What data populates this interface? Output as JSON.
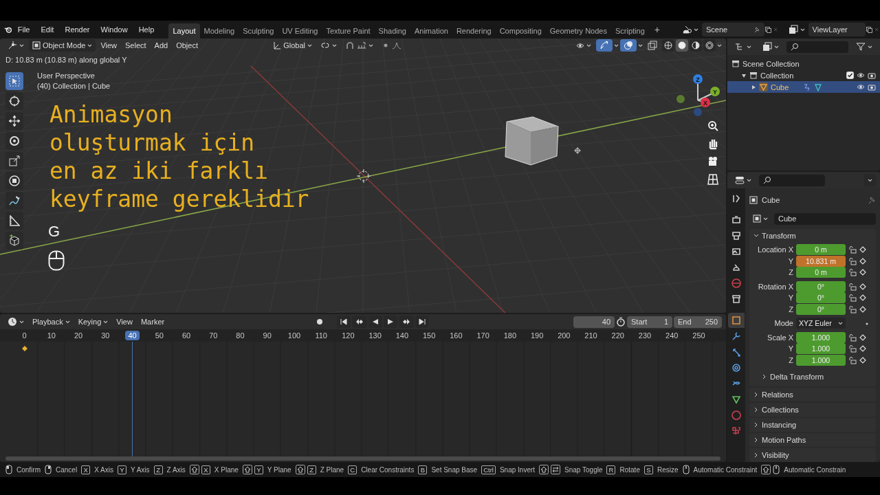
{
  "menu": [
    "File",
    "Edit",
    "Render",
    "Window",
    "Help"
  ],
  "workspaces": [
    {
      "label": "Layout",
      "selected": true
    },
    {
      "label": "Modeling",
      "selected": false
    },
    {
      "label": "Sculpting",
      "selected": false
    },
    {
      "label": "UV Editing",
      "selected": false
    },
    {
      "label": "Texture Paint",
      "selected": false
    },
    {
      "label": "Shading",
      "selected": false
    },
    {
      "label": "Animation",
      "selected": false
    },
    {
      "label": "Rendering",
      "selected": false
    },
    {
      "label": "Compositing",
      "selected": false
    },
    {
      "label": "Geometry Nodes",
      "selected": false
    },
    {
      "label": "Scripting",
      "selected": false
    }
  ],
  "add_workspace": "+",
  "scene": "Scene",
  "view_layer": "ViewLayer",
  "viewport": {
    "mode": "Object Mode",
    "menus": [
      "View",
      "Select",
      "Add",
      "Object"
    ],
    "orientation": "Global",
    "gizmos_on": true,
    "overlays_on": true,
    "shading": [
      {
        "kind": "wireframe",
        "selected": false
      },
      {
        "kind": "solid",
        "selected": true
      },
      {
        "kind": "material",
        "selected": false
      },
      {
        "kind": "rendered",
        "selected": false
      }
    ],
    "status": "D: 10.83 m (10.83 m) along global Y",
    "perspective": "User Perspective",
    "context": "(40) Collection | Cube",
    "caption": [
      "Animasyon",
      "oluşturmak için",
      "en az iki farklı",
      "keyframe gereklidir"
    ],
    "key_hint": "G",
    "tools": [
      {
        "kind": "select",
        "selected": true
      },
      {
        "kind": "cursor",
        "selected": false
      },
      {
        "kind": "move",
        "selected": false
      },
      {
        "kind": "rotate",
        "selected": false
      },
      {
        "kind": "scale",
        "selected": false
      },
      {
        "kind": "transform",
        "selected": false
      },
      {
        "kind": "annotate",
        "selected": false
      },
      {
        "kind": "measure",
        "selected": false
      },
      {
        "kind": "add-cube",
        "selected": false
      }
    ],
    "axes": [
      {
        "label": "Z",
        "color": "#2f7fe0"
      },
      {
        "label": "Y",
        "color": "#7ab02a"
      },
      {
        "label": "X",
        "color": "#e03048"
      }
    ]
  },
  "outliner": {
    "items": [
      {
        "label": "Scene Collection",
        "children": [
          {
            "label": "Collection",
            "expanded": true,
            "checked": true,
            "selected": false,
            "children": [
              {
                "label": "Cube",
                "expanded": false,
                "selected": true
              }
            ]
          }
        ]
      }
    ]
  },
  "timeline": {
    "menus": [
      "Playback",
      "Keying",
      "View",
      "Marker"
    ],
    "current": "40",
    "start_label": "Start",
    "start": "1",
    "end_label": "End",
    "end": "250",
    "ticks": [
      {
        "label": "0",
        "selected": false
      },
      {
        "label": "10",
        "selected": false
      },
      {
        "label": "20",
        "selected": false
      },
      {
        "label": "30",
        "selected": false
      },
      {
        "label": "40",
        "selected": true
      },
      {
        "label": "50",
        "selected": false
      },
      {
        "label": "60",
        "selected": false
      },
      {
        "label": "70",
        "selected": false
      },
      {
        "label": "80",
        "selected": false
      },
      {
        "label": "90",
        "selected": false
      },
      {
        "label": "100",
        "selected": false
      },
      {
        "label": "110",
        "selected": false
      },
      {
        "label": "120",
        "selected": false
      },
      {
        "label": "130",
        "selected": false
      },
      {
        "label": "140",
        "selected": false
      },
      {
        "label": "150",
        "selected": false
      },
      {
        "label": "160",
        "selected": false
      },
      {
        "label": "170",
        "selected": false
      },
      {
        "label": "180",
        "selected": false
      },
      {
        "label": "190",
        "selected": false
      },
      {
        "label": "200",
        "selected": false
      },
      {
        "label": "210",
        "selected": false
      },
      {
        "label": "220",
        "selected": false
      },
      {
        "label": "230",
        "selected": false
      },
      {
        "label": "240",
        "selected": false
      },
      {
        "label": "250",
        "selected": false
      }
    ]
  },
  "properties": {
    "object_name": "Cube",
    "data_name": "Cube",
    "tabs": [
      {
        "kind": "tool",
        "selected": false
      },
      {
        "kind": "render",
        "selected": false
      },
      {
        "kind": "output",
        "selected": false
      },
      {
        "kind": "view-layer",
        "selected": false
      },
      {
        "kind": "scene",
        "selected": false
      },
      {
        "kind": "world",
        "selected": false
      },
      {
        "kind": "collection",
        "selected": false
      },
      {
        "kind": "object",
        "selected": true
      },
      {
        "kind": "modifier",
        "selected": false
      },
      {
        "kind": "particles",
        "selected": false
      },
      {
        "kind": "physics",
        "selected": false
      },
      {
        "kind": "constraints",
        "selected": false
      },
      {
        "kind": "data",
        "selected": false
      },
      {
        "kind": "material",
        "selected": false
      },
      {
        "kind": "texture",
        "selected": false
      }
    ],
    "transform": {
      "title": "Transform",
      "expanded": true,
      "rows": [
        {
          "kind": "field",
          "label": "Location X",
          "value": "0 m",
          "changed": false
        },
        {
          "kind": "field",
          "label": "Y",
          "value": "10.831 m",
          "changed": true
        },
        {
          "kind": "field",
          "label": "Z",
          "value": "0 m",
          "changed": false
        },
        {
          "kind": "field",
          "label": "Rotation X",
          "value": "0°",
          "changed": false
        },
        {
          "kind": "field",
          "label": "Y",
          "value": "0°",
          "changed": false
        },
        {
          "kind": "field",
          "label": "Z",
          "value": "0°",
          "changed": false
        },
        {
          "kind": "select",
          "label": "Mode",
          "value": "XYZ Euler"
        },
        {
          "kind": "field",
          "label": "Scale X",
          "value": "1.000",
          "changed": false
        },
        {
          "kind": "field",
          "label": "Y",
          "value": "1.000",
          "changed": false
        },
        {
          "kind": "field",
          "label": "Z",
          "value": "1.000",
          "changed": false
        }
      ],
      "subpanel": {
        "title": "Delta Transform",
        "expanded": false
      }
    },
    "panels": [
      {
        "title": "Relations",
        "expanded": false
      },
      {
        "title": "Collections",
        "expanded": false
      },
      {
        "title": "Instancing",
        "expanded": false
      },
      {
        "title": "Motion Paths",
        "expanded": false
      },
      {
        "title": "Visibility",
        "expanded": false
      }
    ]
  },
  "status_bar": [
    {
      "keys": [
        {
          "kind": "mouse-left"
        }
      ],
      "label": "Confirm"
    },
    {
      "keys": [
        {
          "kind": "mouse-right"
        }
      ],
      "label": "Cancel"
    },
    {
      "keys": [
        {
          "kind": "key",
          "text": "X"
        }
      ],
      "label": "X Axis"
    },
    {
      "keys": [
        {
          "kind": "key",
          "text": "Y"
        }
      ],
      "label": "Y Axis"
    },
    {
      "keys": [
        {
          "kind": "key",
          "text": "Z"
        }
      ],
      "label": "Z Axis"
    },
    {
      "keys": [
        {
          "kind": "shift"
        },
        {
          "kind": "key",
          "text": "X"
        }
      ],
      "label": "X Plane"
    },
    {
      "keys": [
        {
          "kind": "shift"
        },
        {
          "kind": "key",
          "text": "Y"
        }
      ],
      "label": "Y Plane"
    },
    {
      "keys": [
        {
          "kind": "shift"
        },
        {
          "kind": "key",
          "text": "Z"
        }
      ],
      "label": "Z Plane"
    },
    {
      "keys": [
        {
          "kind": "key",
          "text": "C"
        }
      ],
      "label": "Clear Constraints"
    },
    {
      "keys": [
        {
          "kind": "key",
          "text": "B"
        }
      ],
      "label": "Set Snap Base"
    },
    {
      "keys": [
        {
          "kind": "key",
          "text": "Ctrl"
        }
      ],
      "label": "Snap Invert"
    },
    {
      "keys": [
        {
          "kind": "shift"
        },
        {
          "kind": "tab"
        }
      ],
      "label": "Snap Toggle"
    },
    {
      "keys": [
        {
          "kind": "key",
          "text": "R"
        }
      ],
      "label": "Rotate"
    },
    {
      "keys": [
        {
          "kind": "key",
          "text": "S"
        }
      ],
      "label": "Resize"
    },
    {
      "keys": [
        {
          "kind": "mouse-middle"
        }
      ],
      "label": "Automatic Constraint"
    },
    {
      "keys": [
        {
          "kind": "shift"
        },
        {
          "kind": "mouse-middle"
        }
      ],
      "label": "Automatic Constrain"
    }
  ]
}
